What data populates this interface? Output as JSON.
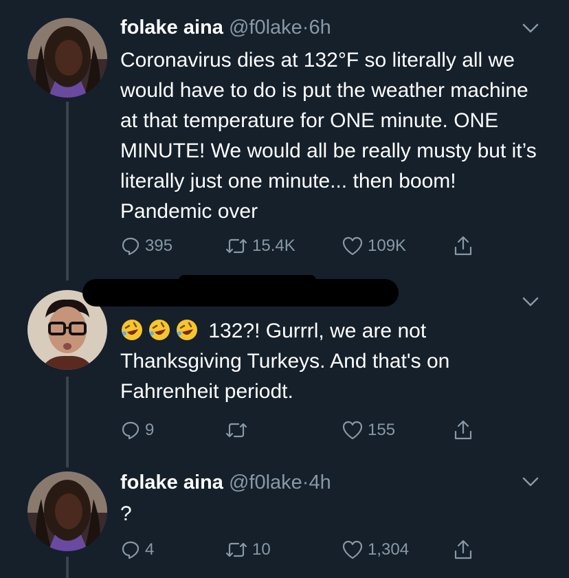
{
  "tweets": [
    {
      "name": "folake aina",
      "handle": "@f0lake",
      "dot": "·",
      "time": "6h",
      "text": "Coronavirus dies at 132°F so literally all we would have to do is put the weather machine at that temperature for ONE minute. ONE MINUTE! We would all be really musty but it’s literally just one minute... then boom! Pandemic over",
      "replies": "395",
      "retweets": "15.4K",
      "likes": "109K"
    },
    {
      "name": "",
      "handle": "",
      "text": "132?! Gurrrl, we are not Thanksgiving Turkeys. And that's on Fahrenheit periodt.",
      "emoji": [
        "rolling-on-floor-laughing",
        "rolling-on-floor-laughing",
        "rolling-on-floor-laughing"
      ],
      "replies": "9",
      "retweets": "",
      "likes": "155"
    },
    {
      "name": "folake aina",
      "handle": "@f0lake",
      "dot": "·",
      "time": "4h",
      "text": "?",
      "replies": "4",
      "retweets": "10",
      "likes": "1,304"
    }
  ],
  "colors": {
    "background": "#15202b",
    "muted": "#8899a6",
    "thread_line": "#38444d",
    "text": "#ffffff"
  },
  "icons": [
    "reply-icon",
    "retweet-icon",
    "like-icon",
    "share-icon",
    "chevron-down-icon"
  ]
}
